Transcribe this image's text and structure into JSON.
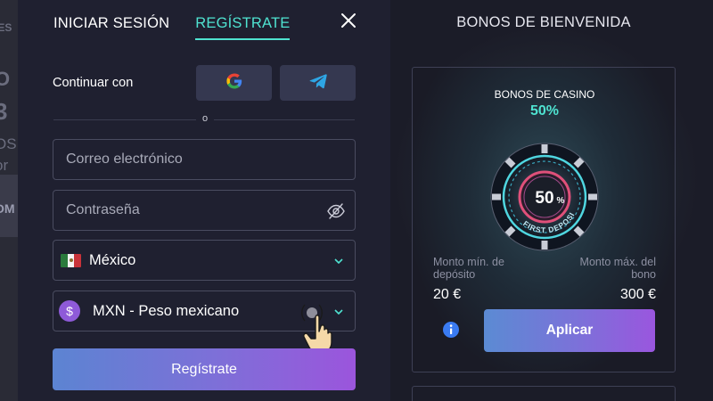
{
  "background": {
    "fragments": [
      "IES",
      "O",
      "3",
      "OS",
      "or",
      "OM"
    ]
  },
  "auth": {
    "tabs": [
      {
        "label": "INICIAR SESIÓN",
        "active": false
      },
      {
        "label": "REGÍSTRATE",
        "active": true
      }
    ],
    "continue_label": "Continuar con",
    "social": [
      {
        "name": "google-icon"
      },
      {
        "name": "telegram-icon"
      }
    ],
    "divider_text": "o",
    "email_placeholder": "Correo electrónico",
    "password_placeholder": "Contraseña",
    "country_value": "México",
    "currency_value": "MXN - Peso mexicano",
    "currency_symbol": "$",
    "register_label": "Regístrate"
  },
  "bonus": {
    "heading": "BONOS DE BIENVENIDA",
    "casino_label": "BONOS DE CASINO",
    "casino_percent": "50%",
    "chip_value": "50",
    "chip_percent": "%",
    "chip_caption": "FIRST DEPOSIT",
    "min_label": "Monto mín. de depósito",
    "max_label": "Monto máx. del bono",
    "min_value": "20 €",
    "max_value": "300 €",
    "apply_label": "Aplicar"
  },
  "colors": {
    "accent": "#4fe3d1",
    "panel": "#1f2030",
    "button_gradient_start": "#5c84d2",
    "button_gradient_end": "#9b55dc",
    "mexico_green": "#2a7a3c",
    "mexico_red": "#c8333a"
  }
}
